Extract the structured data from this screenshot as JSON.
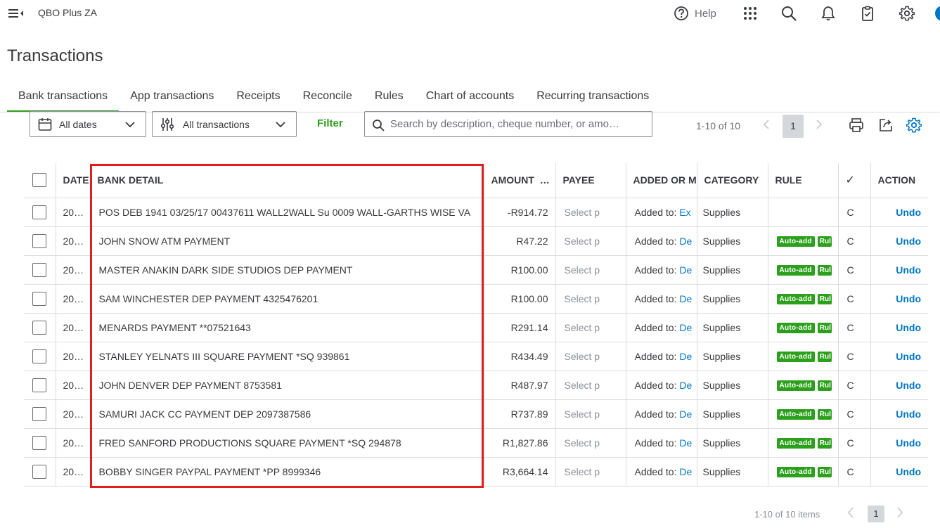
{
  "app": {
    "name": "QBO Plus ZA",
    "help_label": "Help"
  },
  "page": {
    "title": "Transactions"
  },
  "tabs": [
    {
      "label": "Bank transactions",
      "active": true
    },
    {
      "label": "App transactions"
    },
    {
      "label": "Receipts"
    },
    {
      "label": "Reconcile"
    },
    {
      "label": "Rules"
    },
    {
      "label": "Chart of accounts"
    },
    {
      "label": "Recurring transactions"
    }
  ],
  "toolbar": {
    "date_filter": "All dates",
    "type_filter": "All transactions",
    "filter_label": "Filter",
    "search_placeholder": "Search by description, cheque number, or amo…",
    "pager_text": "1-10 of 10",
    "page_number": "1"
  },
  "table": {
    "headers": {
      "date": "DATE",
      "bank_detail": "BANK DETAIL",
      "amount": "AMOUNT",
      "amount_more": "…",
      "payee": "PAYEE",
      "added_or_matched": "ADDED OR M",
      "category": "CATEGORY",
      "rule": "RULE",
      "status": "✓",
      "action": "ACTION"
    },
    "rows": [
      {
        "date": "20…",
        "detail": "POS DEB 1941 03/25/17 00437611 WALL2WALL Su 0009 WALL-GARTHS WISE VA",
        "amount": "-R914.72",
        "payee": "Select p",
        "added_prefix": "Added to:",
        "added_link": "Ex",
        "category": "Supplies",
        "rule": "",
        "rule_extra": "",
        "status": "C",
        "action": "Undo"
      },
      {
        "date": "20…",
        "detail": "JOHN SNOW ATM PAYMENT",
        "amount": "R47.22",
        "payee": "Select p",
        "added_prefix": "Added to:",
        "added_link": "De",
        "category": "Supplies",
        "rule": "Auto-add",
        "rule_extra": "Rul",
        "status": "C",
        "action": "Undo"
      },
      {
        "date": "20…",
        "detail": "MASTER ANAKIN DARK SIDE STUDIOS DEP PAYMENT",
        "amount": "R100.00",
        "payee": "Select p",
        "added_prefix": "Added to:",
        "added_link": "De",
        "category": "Supplies",
        "rule": "Auto-add",
        "rule_extra": "Rul",
        "status": "C",
        "action": "Undo"
      },
      {
        "date": "20…",
        "detail": "SAM WINCHESTER DEP PAYMENT 4325476201",
        "amount": "R100.00",
        "payee": "Select p",
        "added_prefix": "Added to:",
        "added_link": "De",
        "category": "Supplies",
        "rule": "Auto-add",
        "rule_extra": "Rul",
        "status": "C",
        "action": "Undo"
      },
      {
        "date": "20…",
        "detail": "MENARDS PAYMENT **07521643",
        "amount": "R291.14",
        "payee": "Select p",
        "added_prefix": "Added to:",
        "added_link": "De",
        "category": "Supplies",
        "rule": "Auto-add",
        "rule_extra": "Rul",
        "status": "C",
        "action": "Undo"
      },
      {
        "date": "20…",
        "detail": "STANLEY YELNATS III SQUARE PAYMENT *SQ 939861",
        "amount": "R434.49",
        "payee": "Select p",
        "added_prefix": "Added to:",
        "added_link": "De",
        "category": "Supplies",
        "rule": "Auto-add",
        "rule_extra": "Rul",
        "status": "C",
        "action": "Undo"
      },
      {
        "date": "20…",
        "detail": "JOHN DENVER DEP PAYMENT 8753581",
        "amount": "R487.97",
        "payee": "Select p",
        "added_prefix": "Added to:",
        "added_link": "De",
        "category": "Supplies",
        "rule": "Auto-add",
        "rule_extra": "Rul",
        "status": "C",
        "action": "Undo"
      },
      {
        "date": "20…",
        "detail": "SAMURI JACK CC PAYMENT DEP 2097387586",
        "amount": "R737.89",
        "payee": "Select p",
        "added_prefix": "Added to:",
        "added_link": "De",
        "category": "Supplies",
        "rule": "Auto-add",
        "rule_extra": "Rul",
        "status": "C",
        "action": "Undo"
      },
      {
        "date": "20…",
        "detail": "FRED SANFORD PRODUCTIONS SQUARE PAYMENT *SQ 294878",
        "amount": "R1,827.86",
        "payee": "Select p",
        "added_prefix": "Added to:",
        "added_link": "De",
        "category": "Supplies",
        "rule": "Auto-add",
        "rule_extra": "Rul",
        "status": "C",
        "action": "Undo"
      },
      {
        "date": "20…",
        "detail": "BOBBY SINGER PAYPAL PAYMENT *PP 8999346",
        "amount": "R3,664.14",
        "payee": "Select p",
        "added_prefix": "Added to:",
        "added_link": "De",
        "category": "Supplies",
        "rule": "Auto-add",
        "rule_extra": "Rul",
        "status": "C",
        "action": "Undo"
      }
    ]
  },
  "footer": {
    "pager_text": "1-10 of 10 items",
    "page_number": "1"
  },
  "colors": {
    "accent_green": "#2ca01c",
    "link_blue": "#0077c5",
    "highlight_red": "#e01e1e",
    "text": "#393a3d"
  }
}
